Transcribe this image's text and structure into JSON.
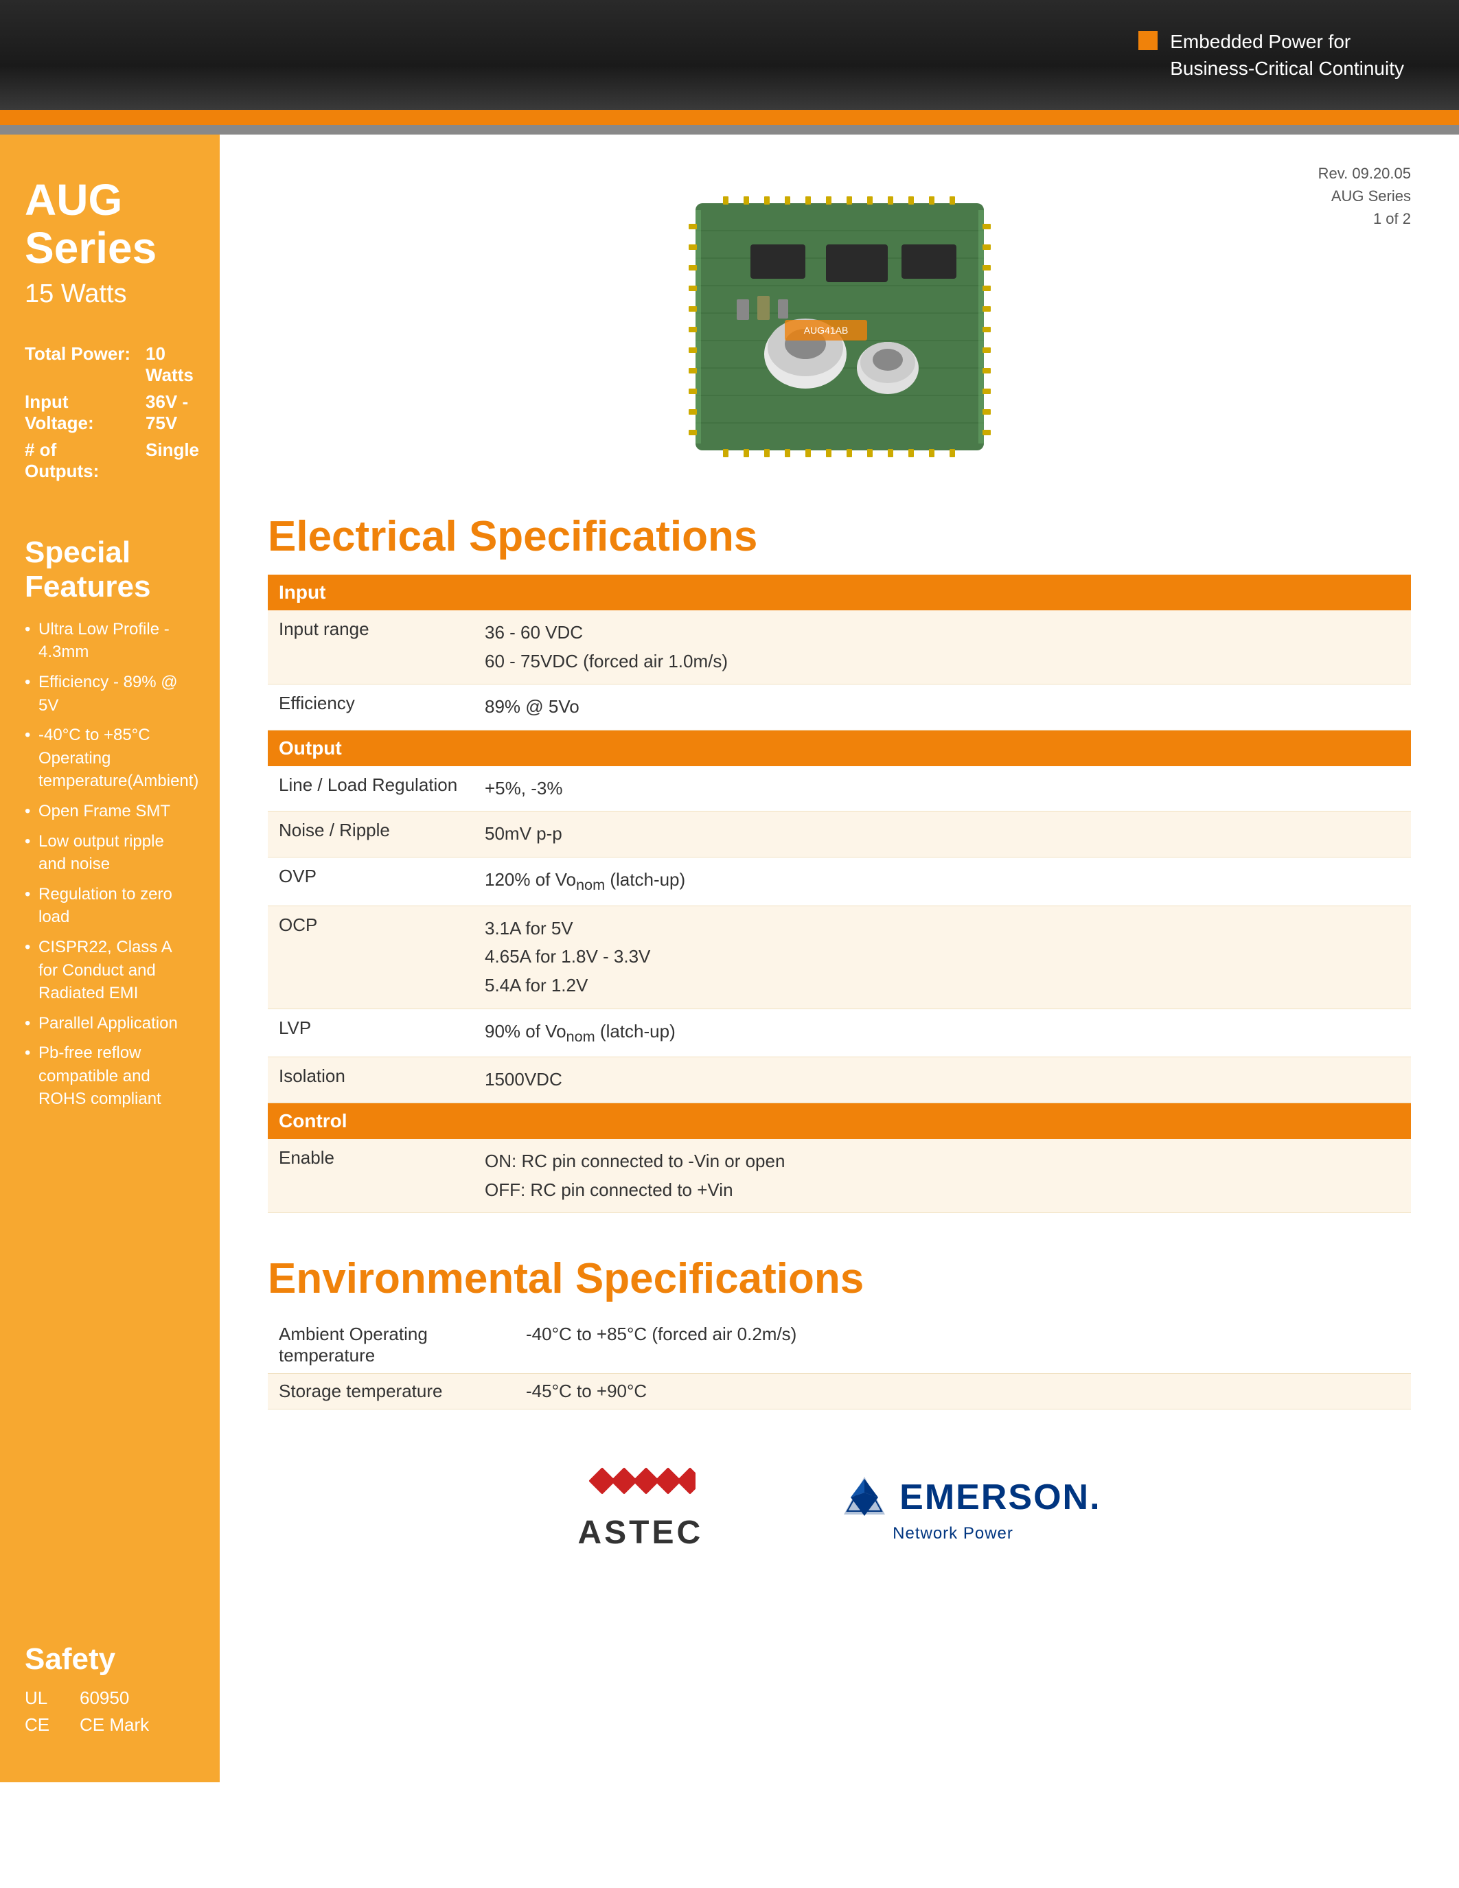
{
  "header": {
    "badge_text_line1": "Embedded Power for",
    "badge_text_line2": "Business-Critical Continuity"
  },
  "rev_info": {
    "line1": "Rev. 09.20.05",
    "line2": "AUG Series",
    "line3": "1 of 2"
  },
  "sidebar": {
    "title": "AUG Series",
    "subtitle": "15 Watts",
    "specs": [
      {
        "label": "Total Power:",
        "value": "10 Watts"
      },
      {
        "label": "Input Voltage:",
        "value": "36V - 75V"
      },
      {
        "label": "# of Outputs:",
        "value": "Single"
      }
    ],
    "features_title": "Special Features",
    "features": [
      "Ultra Low Profile - 4.3mm",
      "Efficiency - 89% @ 5V",
      "-40°C to +85°C Operating temperature(Ambient)",
      "Open Frame SMT",
      "Low output ripple and noise",
      "Regulation to zero load",
      "CISPR22, Class A for Conduct and Radiated EMI",
      "Parallel Application",
      "Pb-free reflow compatible and ROHS compliant"
    ],
    "safety_title": "Safety",
    "safety": [
      {
        "label": "UL",
        "value": "60950"
      },
      {
        "label": "CE",
        "value": "CE Mark"
      }
    ]
  },
  "electrical_specs": {
    "title": "Electrical Specifications",
    "sections": [
      {
        "header": "Input",
        "rows": [
          {
            "param": "Input range",
            "value": "36 - 60 VDC\n60 - 75VDC (forced air 1.0m/s)"
          },
          {
            "param": "Efficiency",
            "value": "89% @ 5Vo"
          }
        ]
      },
      {
        "header": "Output",
        "rows": [
          {
            "param": "Line / Load Regulation",
            "value": "+5%, -3%"
          },
          {
            "param": "Noise / Ripple",
            "value": "50mV p-p"
          },
          {
            "param": "OVP",
            "value": "120% of Vonom (latch-up)"
          },
          {
            "param": "OCP",
            "value": "3.1A for 5V\n4.65A for 1.8V - 3.3V\n5.4A for 1.2V"
          },
          {
            "param": "LVP",
            "value": "90% of Vonom (latch-up)"
          },
          {
            "param": "Isolation",
            "value": "1500VDC"
          }
        ]
      },
      {
        "header": "Control",
        "rows": [
          {
            "param": "Enable",
            "value": "ON: RC pin connected to -Vin or open\nOFF: RC pin connected to +Vin"
          }
        ]
      }
    ]
  },
  "environmental_specs": {
    "title": "Environmental Specifications",
    "rows": [
      {
        "param": "Ambient Operating temperature",
        "value": "-40°C to +85°C (forced air 0.2m/s)"
      },
      {
        "param": "Storage temperature",
        "value": "-45°C to +90°C"
      }
    ]
  },
  "logos": {
    "astec_text": "ASTEC",
    "emerson_text": "EMERSON.",
    "emerson_subtitle": "Network Power"
  }
}
